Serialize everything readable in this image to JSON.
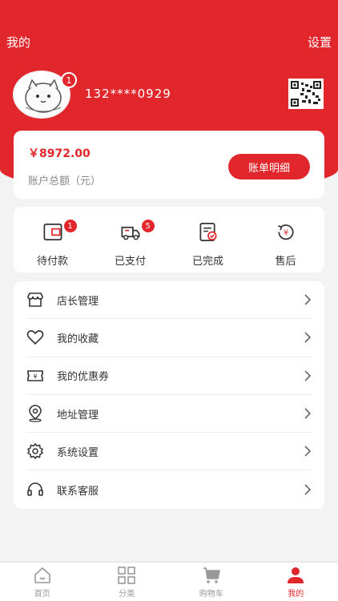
{
  "topbar": {
    "title": "我的",
    "settings_label": "设置"
  },
  "profile": {
    "phone": "132****0929",
    "avatar_badge": "1"
  },
  "balance": {
    "amount": "￥8972.00",
    "label": "账户总额（元）",
    "bill_button": "账单明细"
  },
  "orders": [
    {
      "label": "待付款",
      "badge": "1",
      "icon": "wallet-icon"
    },
    {
      "label": "已支付",
      "badge": "5",
      "icon": "truck-icon"
    },
    {
      "label": "已完成",
      "badge": "",
      "icon": "completed-icon"
    },
    {
      "label": "售后",
      "badge": "",
      "icon": "after-sale-icon"
    }
  ],
  "menu": [
    {
      "label": "店长管理",
      "icon": "store-icon"
    },
    {
      "label": "我的收藏",
      "icon": "heart-icon"
    },
    {
      "label": "我的优惠券",
      "icon": "coupon-icon"
    },
    {
      "label": "地址管理",
      "icon": "location-icon"
    },
    {
      "label": "系统设置",
      "icon": "gear-icon"
    },
    {
      "label": "联系客服",
      "icon": "headset-icon"
    }
  ],
  "bottom_nav": [
    {
      "label": "首页",
      "icon": "home-icon",
      "active": false
    },
    {
      "label": "分类",
      "icon": "category-icon",
      "active": false
    },
    {
      "label": "购物车",
      "icon": "cart-icon",
      "active": false
    },
    {
      "label": "我的",
      "icon": "user-icon",
      "active": true
    }
  ],
  "colors": {
    "primary": "#e1262c",
    "background": "#f3f3f3",
    "card": "#ffffff"
  }
}
